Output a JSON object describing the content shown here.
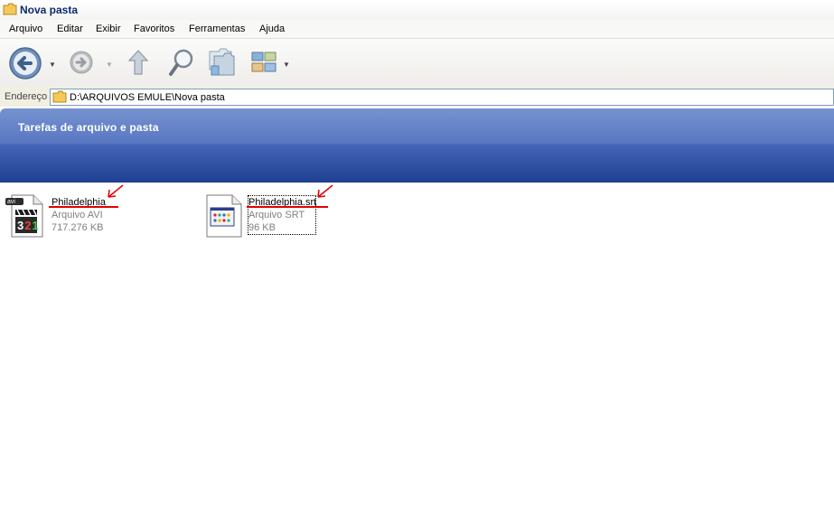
{
  "window": {
    "title": "Nova pasta"
  },
  "menu": {
    "items": [
      "Arquivo",
      "Editar",
      "Exibir",
      "Favoritos",
      "Ferramentas",
      "Ajuda"
    ]
  },
  "address": {
    "label": "Endereço",
    "path": "D:\\ARQUIVOS EMULE\\Nova pasta"
  },
  "task_pane": {
    "title": "Tarefas de arquivo e pasta"
  },
  "files": [
    {
      "name": "Philadelphia",
      "type": "Arquivo AVI",
      "size": "717.276 KB",
      "icon": "media-player-classic-avi-icon",
      "badge": "avi"
    },
    {
      "name": "Philadelphia.srt",
      "type": "Arquivo SRT",
      "size": "96 KB",
      "icon": "srt-document-icon"
    }
  ],
  "colors": {
    "annotation": "#e00000",
    "taskpane": "#2f4f9f",
    "title": "#0d2a6b"
  }
}
